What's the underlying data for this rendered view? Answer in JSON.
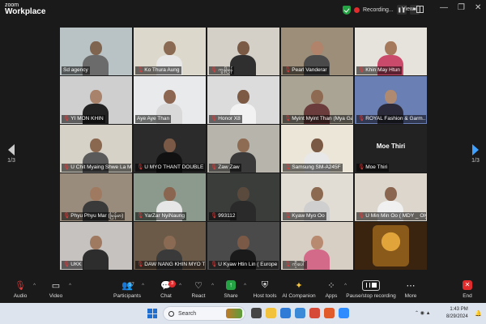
{
  "app": {
    "brand_line1": "zoom",
    "brand_line2": "Workplace"
  },
  "titlebar": {
    "recording": "Recording...",
    "view": "View"
  },
  "pager": {
    "left": "1/3",
    "right": "1/3"
  },
  "tiles": [
    {
      "name": "Sd agency",
      "mic_off": false,
      "active": true,
      "bg": "#b9c2c4",
      "skin": "#7f6450",
      "shirt": "#6b6b6b",
      "scene": "room"
    },
    {
      "name": "Ko Thura Aung",
      "mic_off": true,
      "bg": "#ddd8cc",
      "skin": "#8a6a52",
      "shirt": "#e8e8e8"
    },
    {
      "name": "ကွန်မြန်",
      "mic_off": true,
      "bg": "#d4d0c8",
      "skin": "#7a5a44",
      "shirt": "#2f2f2f"
    },
    {
      "name": "Pearl Vanderar",
      "mic_off": true,
      "bg": "#9c8e78",
      "skin": "#b0836a",
      "shirt": "#4a4a4a"
    },
    {
      "name": "Khin May Htun",
      "mic_off": true,
      "bg": "#e6e2dc",
      "skin": "#a57a5c",
      "shirt": "#c94a6a"
    },
    {
      "name": "YI MON KHIN",
      "mic_off": true,
      "bg": "#cfcfcf",
      "skin": "#a8826a",
      "shirt": "#222"
    },
    {
      "name": "Aye Aye Than",
      "mic_off": false,
      "bg": "#e9eaec",
      "skin": "#8c6650",
      "shirt": "#d9d9d9"
    },
    {
      "name": "Honor X8",
      "mic_off": true,
      "bg": "#dcdcdc",
      "skin": "#7c5a44",
      "shirt": "#f2f2f2"
    },
    {
      "name": "Myint Myint Than (Mya Ga...",
      "mic_off": true,
      "bg": "#a9a494",
      "skin": "#8e6a52",
      "shirt": "#6a3c3c"
    },
    {
      "name": "ROYAL Fashion & Garm...",
      "mic_off": true,
      "bg": "#6a7fb4",
      "skin": "#b08a70",
      "shirt": "#2a2a3a"
    },
    {
      "name": "U Chit Myaing Shwe La Min...",
      "mic_off": true,
      "bg": "#d7d2c8",
      "skin": "#8a6850",
      "shirt": "#5a5a5a"
    },
    {
      "name": "U MYO THANT DOUBLE RHIN...",
      "mic_off": true,
      "bg": "#2b2b2b",
      "skin": "#7a5a46",
      "shirt": "#111"
    },
    {
      "name": "Zaw Zaw",
      "mic_off": true,
      "bg": "#b7b4ab",
      "skin": "#8e6c54",
      "shirt": "#3a3a3a"
    },
    {
      "name": "Samsung SM-A245F",
      "mic_off": true,
      "bg": "#ece6d8",
      "skin": "#7a5a44",
      "shirt": "#e8e8e8"
    },
    {
      "name": "Moe Thiri",
      "mic_off": true,
      "text_only": true,
      "big_label": "Moe Thiri"
    },
    {
      "name": "Phyu Phyu Mar (မြန်မာ)",
      "mic_off": true,
      "bg": "#9a8c7c",
      "skin": "#a07a60",
      "shirt": "#3a3a3a"
    },
    {
      "name": "YarZar NyiNaung",
      "mic_off": true,
      "bg": "#8b9a8c",
      "skin": "#8a6650",
      "shirt": "#e6e6e6"
    },
    {
      "name": "993112",
      "mic_off": true,
      "bg": "#3a3d3a",
      "skin": "#5a4a3e",
      "shirt": "#2a2a2a"
    },
    {
      "name": "Kyaw Myo Oo",
      "mic_off": true,
      "bg": "#e2ddd4",
      "skin": "#8c6a52",
      "shirt": "#cfcfcf"
    },
    {
      "name": "U Min Min Oo ( MDY _ Oly...",
      "mic_off": true,
      "bg": "#dcd6cc",
      "skin": "#8a6650",
      "shirt": "#f0f0f0"
    },
    {
      "name": "UKK",
      "mic_off": true,
      "bg": "#c6c2c0",
      "skin": "#a07a60",
      "shirt": "#2d2d2d"
    },
    {
      "name": "DAW NANG KHIN MYO TUN",
      "mic_off": true,
      "bg": "#6b5a48",
      "skin": "#8a6a52",
      "shirt": "#3a3a3a"
    },
    {
      "name": "U Kyaw Htin Lin ( Europe &...",
      "mic_off": true,
      "bg": "#4a4a4a",
      "skin": "#7a5a46",
      "shirt": "#1a1a1a"
    },
    {
      "name": "ကိုပေါ်",
      "mic_off": true,
      "bg": "#d7cfc4",
      "skin": "#b88a70",
      "shirt": "#d46a8a"
    },
    {
      "name": "",
      "mic_off": false,
      "logo": true,
      "bg": "#3a2410"
    }
  ],
  "toolbar": {
    "audio": "Audio",
    "video": "Video",
    "participants": "Participants",
    "participants_count": "57",
    "chat": "Chat",
    "chat_badge": "3",
    "react": "React",
    "share": "Share",
    "host_tools": "Host tools",
    "ai_companion": "AI Companion",
    "apps": "Apps",
    "pause_record": "Pause/stop recording",
    "more": "More",
    "end": "End"
  },
  "taskbar": {
    "search": "Search",
    "time": "1:43 PM",
    "date": "8/29/2024"
  }
}
